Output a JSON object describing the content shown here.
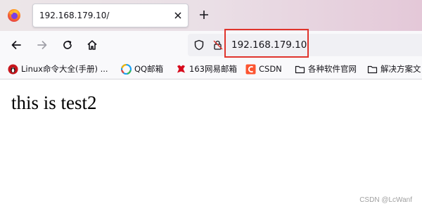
{
  "browser": {
    "tab": {
      "title": "192.168.179.10/"
    },
    "address_bar": {
      "url": "192.168.179.10"
    },
    "bookmarks": [
      {
        "label": "Linux命令大全(手册) ...",
        "icon": "linux-icon"
      },
      {
        "label": "QQ邮箱",
        "icon": "qq-mail-icon"
      },
      {
        "label": "163网易邮箱",
        "icon": "netease-163-icon"
      },
      {
        "label": "CSDN",
        "icon": "csdn-icon"
      },
      {
        "label": "各种软件官网",
        "icon": "folder-icon"
      },
      {
        "label": "解决方案文",
        "icon": "folder-icon"
      }
    ],
    "colors": {
      "highlight_border": "#e0342c",
      "csdn_brand": "#fc5531"
    }
  },
  "page": {
    "body_text": "this is test2"
  },
  "watermark": "CSDN @LcWanf"
}
